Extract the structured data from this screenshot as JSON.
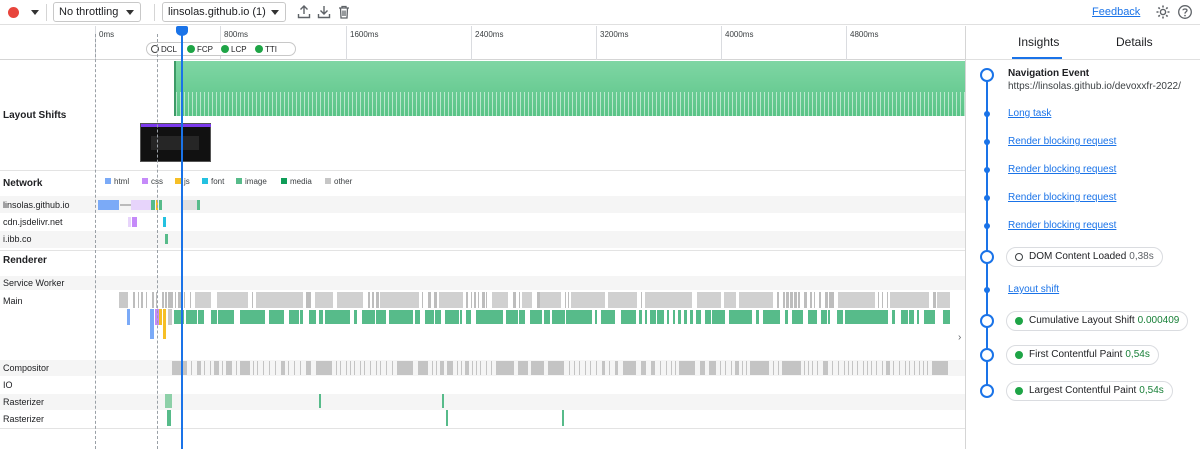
{
  "toolbar": {
    "throttling": "No throttling",
    "recording": "linsolas.github.io (1)",
    "feedback": "Feedback"
  },
  "ruler": {
    "ticks": [
      "0ms",
      "800ms",
      "1600ms",
      "2400ms",
      "3200ms",
      "4000ms",
      "4800ms"
    ],
    "markers": [
      "DCL",
      "FCP",
      "LCP",
      "TTI"
    ]
  },
  "tracks": {
    "layout_shifts": "Layout Shifts",
    "network": "Network",
    "network_rows": [
      "linsolas.github.io",
      "cdn.jsdelivr.net",
      "i.ibb.co"
    ],
    "renderer": "Renderer",
    "renderer_rows": [
      "Service Worker",
      "Main"
    ],
    "other_rows": [
      "Compositor",
      "IO",
      "Rasterizer",
      "Rasterizer"
    ]
  },
  "legend": [
    {
      "label": "html",
      "color": "#7baaf7"
    },
    {
      "label": "css",
      "color": "#c58af9"
    },
    {
      "label": "js",
      "color": "#f6bf26"
    },
    {
      "label": "font",
      "color": "#24c1e0"
    },
    {
      "label": "image",
      "color": "#57bb8a"
    },
    {
      "label": "media",
      "color": "#0f9d58"
    },
    {
      "label": "other",
      "color": "#c6c6c6"
    }
  ],
  "colors": {
    "accent": "#1a73e8",
    "record": "#e8453c",
    "good": "#1ea446",
    "layout_shift_fill": "#7fd6a4"
  },
  "sidebar": {
    "tabs": [
      "Insights",
      "Details"
    ],
    "event_title": "Navigation Event",
    "event_url": "https://linsolas.github.io/devoxxfr-2022/",
    "items": [
      {
        "type": "link",
        "label": "Long task"
      },
      {
        "type": "link",
        "label": "Render blocking request"
      },
      {
        "type": "link",
        "label": "Render blocking request"
      },
      {
        "type": "link",
        "label": "Render blocking request"
      },
      {
        "type": "link",
        "label": "Render blocking request"
      },
      {
        "type": "metric",
        "label": "DOM Content Loaded",
        "value": "0,38s"
      },
      {
        "type": "link",
        "label": "Layout shift"
      },
      {
        "type": "metric",
        "label": "Cumulative Layout Shift",
        "value": "0.000409"
      },
      {
        "type": "metric",
        "label": "First Contentful Paint",
        "value": "0,54s"
      },
      {
        "type": "metric",
        "label": "Largest Contentful Paint",
        "value": "0,54s"
      }
    ]
  }
}
